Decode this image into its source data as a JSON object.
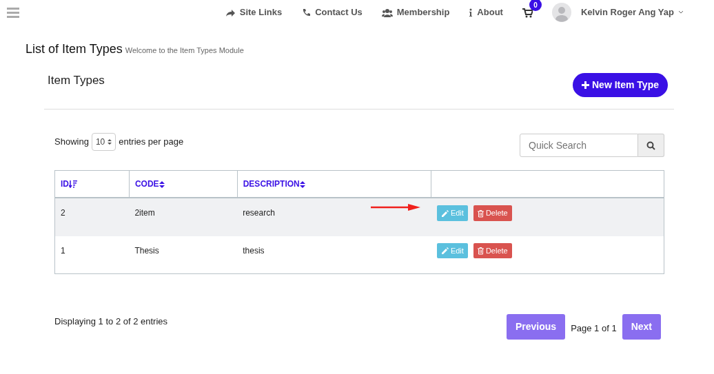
{
  "navbar": {
    "links": [
      {
        "kind": "share",
        "label": "Site Links"
      },
      {
        "kind": "phone",
        "label": "Contact Us"
      },
      {
        "kind": "users",
        "label": "Membership"
      },
      {
        "kind": "info",
        "label": "About"
      }
    ],
    "cart": {
      "count": "0"
    },
    "user": {
      "name": "Kelvin Roger Ang Yap"
    }
  },
  "page": {
    "title": "List of Item Types",
    "subtitle": "Welcome to the Item Types Module"
  },
  "panel": {
    "title": "Item Types",
    "new_button": "New Item Type"
  },
  "length": {
    "prefix": "Showing",
    "value": "10",
    "suffix": "entries per page"
  },
  "search": {
    "placeholder": "Quick Search"
  },
  "table": {
    "columns": [
      {
        "label": "ID",
        "kind": "sorted"
      },
      {
        "label": "CODE",
        "kind": "sortable"
      },
      {
        "label": "DESCRIPTION",
        "kind": "sortable"
      }
    ],
    "rows": [
      {
        "cells": [
          "2",
          "2item",
          "research"
        ],
        "selected": true,
        "edit": "Edit",
        "delete": "Delete"
      },
      {
        "cells": [
          "1",
          "Thesis",
          "thesis"
        ],
        "selected": false,
        "edit": "Edit",
        "delete": "Delete"
      }
    ]
  },
  "annotation": {
    "kind": "arrow"
  },
  "footer": {
    "info": "Displaying 1 to 2 of 2 entries",
    "previous": {
      "label": "Previous",
      "disabled": true
    },
    "page": "Page 1 of 1",
    "next": {
      "label": "Next",
      "disabled": true
    }
  }
}
